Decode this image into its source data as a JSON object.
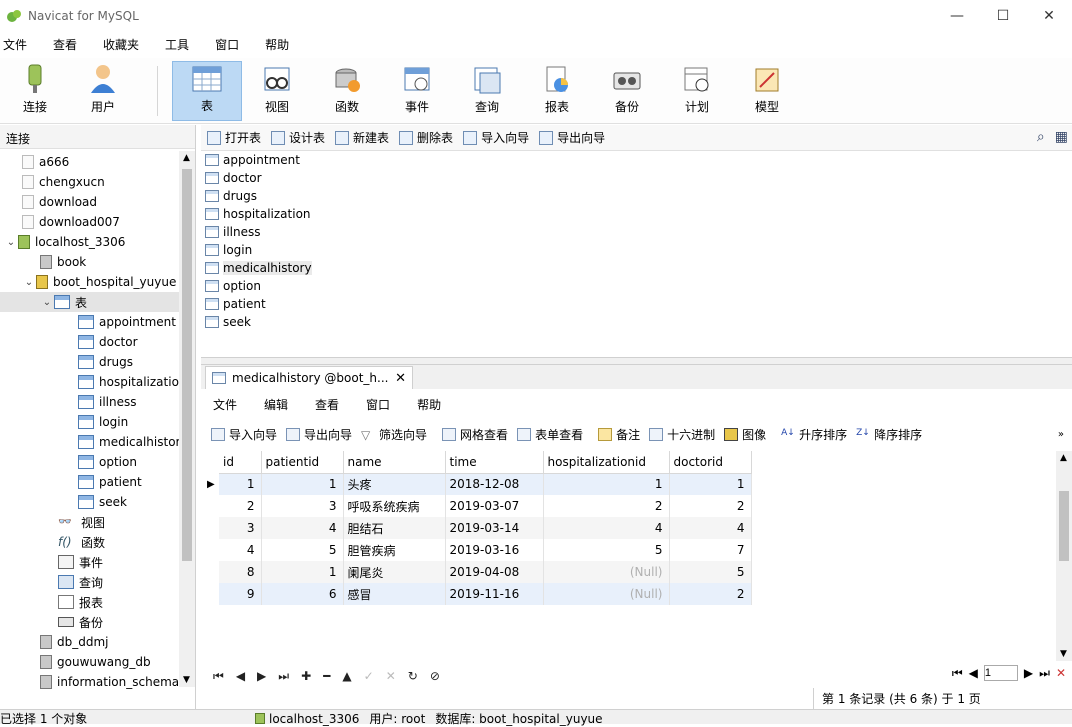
{
  "window": {
    "title": "Navicat for MySQL",
    "controls": {
      "minimize": "—",
      "maximize": "☐",
      "close": "✕"
    }
  },
  "menu": [
    "文件",
    "查看",
    "收藏夹",
    "工具",
    "窗口",
    "帮助"
  ],
  "toolbar": [
    {
      "label": "连接",
      "icon": "connection-icon"
    },
    {
      "label": "用户",
      "icon": "user-icon"
    },
    {
      "label": "表",
      "icon": "table-icon",
      "active": true
    },
    {
      "label": "视图",
      "icon": "view-icon"
    },
    {
      "label": "函数",
      "icon": "function-icon"
    },
    {
      "label": "事件",
      "icon": "event-icon"
    },
    {
      "label": "查询",
      "icon": "query-icon"
    },
    {
      "label": "报表",
      "icon": "report-icon"
    },
    {
      "label": "备份",
      "icon": "backup-icon"
    },
    {
      "label": "计划",
      "icon": "schedule-icon"
    },
    {
      "label": "模型",
      "icon": "model-icon"
    }
  ],
  "left": {
    "header": "连接",
    "tree": [
      {
        "label": "a666"
      },
      {
        "label": "chengxucn"
      },
      {
        "label": "download"
      },
      {
        "label": "download007"
      },
      {
        "label": "localhost_3306"
      },
      {
        "label": "book"
      },
      {
        "label": "boot_hospital_yuyue"
      },
      {
        "label": "表"
      },
      {
        "label": "appointment"
      },
      {
        "label": "doctor"
      },
      {
        "label": "drugs"
      },
      {
        "label": "hospitalization"
      },
      {
        "label": "illness"
      },
      {
        "label": "login"
      },
      {
        "label": "medicalhistory"
      },
      {
        "label": "option"
      },
      {
        "label": "patient"
      },
      {
        "label": "seek"
      },
      {
        "label": "视图"
      },
      {
        "label": "函数"
      },
      {
        "label": "事件"
      },
      {
        "label": "查询"
      },
      {
        "label": "报表"
      },
      {
        "label": "备份"
      },
      {
        "label": "db_ddmj"
      },
      {
        "label": "gouwuwang_db"
      },
      {
        "label": "information_schema"
      }
    ]
  },
  "objbar": [
    "打开表",
    "设计表",
    "新建表",
    "删除表",
    "导入向导",
    "导出向导"
  ],
  "objects": [
    "appointment",
    "doctor",
    "drugs",
    "hospitalization",
    "illness",
    "login",
    "medicalhistory",
    "option",
    "patient",
    "seek"
  ],
  "tab": {
    "label": "medicalhistory @boot_h...",
    "close": "✕"
  },
  "submenu": [
    "文件",
    "编辑",
    "查看",
    "窗口",
    "帮助"
  ],
  "subtools": [
    "导入向导",
    "导出向导",
    "筛选向导",
    "网格查看",
    "表单查看",
    "备注",
    "十六进制",
    "图像",
    "升序排序",
    "降序排序"
  ],
  "grid": {
    "columns": [
      "id",
      "patientid",
      "name",
      "time",
      "hospitalizationid",
      "doctorid"
    ],
    "rows": [
      [
        "1",
        "1",
        "头疼",
        "2018-12-08",
        "1",
        "1"
      ],
      [
        "2",
        "3",
        "呼吸系统疾病",
        "2019-03-07",
        "2",
        "2"
      ],
      [
        "3",
        "4",
        "胆结石",
        "2019-03-14",
        "4",
        "4"
      ],
      [
        "4",
        "5",
        "胆管疾病",
        "2019-03-16",
        "5",
        "7"
      ],
      [
        "8",
        "1",
        "阑尾炎",
        "2019-04-08",
        "(Null)",
        "5"
      ],
      [
        "9",
        "6",
        "感冒",
        "2019-11-16",
        "(Null)",
        "2"
      ]
    ]
  },
  "pager": {
    "page": "1",
    "record_info": "第 1 条记录 (共 6 条) 于 1 页"
  },
  "status": {
    "selection": "已选择 1 个对象",
    "connection": "localhost_3306",
    "user": "用户: root",
    "database": "数据库: boot_hospital_yuyue"
  }
}
